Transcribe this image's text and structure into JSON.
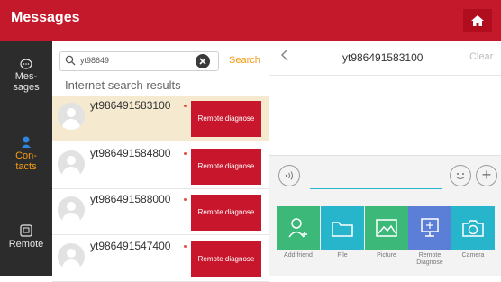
{
  "header": {
    "title": "Messages"
  },
  "sidebar": {
    "items": [
      {
        "label": "Mes-\nsages",
        "icon": "chat-bubble-icon",
        "active": false
      },
      {
        "label": "Con-\ntacts",
        "icon": "person-icon",
        "active": true
      },
      {
        "label": "Remote",
        "icon": "remote-icon",
        "active": false
      }
    ]
  },
  "search": {
    "value": "yt98649",
    "button": "Search"
  },
  "results": {
    "header": "Internet search results",
    "action_label": "Remote diagnose",
    "items": [
      {
        "name": "yt986491583100"
      },
      {
        "name": "yt986491584800"
      },
      {
        "name": "yt986491588000"
      },
      {
        "name": "yt986491547400"
      }
    ]
  },
  "chat": {
    "peer": "yt986491583100",
    "clear_label": "Clear",
    "actions": [
      {
        "label": "Add friend",
        "color": "#3cb878"
      },
      {
        "label": "File",
        "color": "#27b5cc"
      },
      {
        "label": "Picture",
        "color": "#3cb878"
      },
      {
        "label": "Remote\nDiagnose",
        "color": "#5b7fd6"
      },
      {
        "label": "Camera",
        "color": "#27b5cc"
      }
    ]
  },
  "colors": {
    "brand": "#c4182b",
    "accent": "#f39c12"
  }
}
